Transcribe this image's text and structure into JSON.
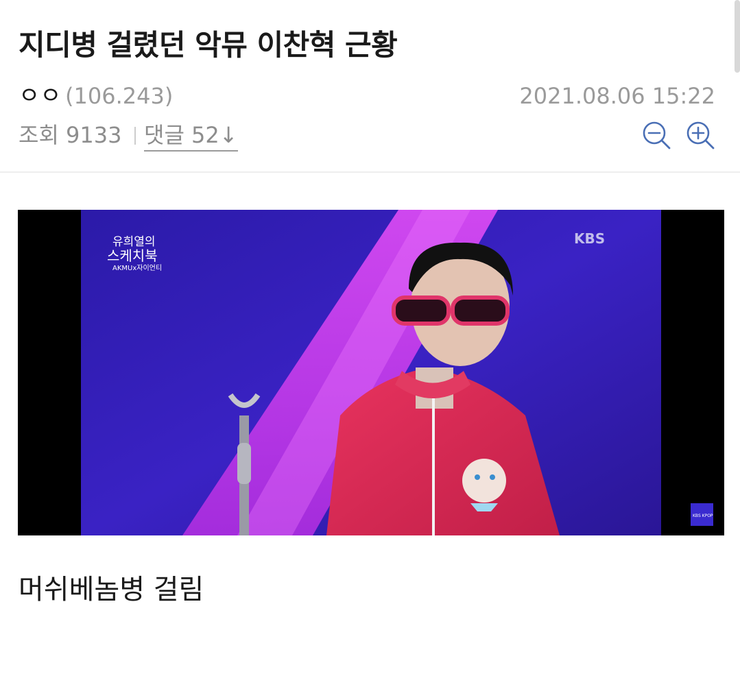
{
  "post": {
    "title": "지디병 걸렸던 악뮤 이찬혁 근황",
    "author": "ㅇㅇ",
    "author_ip": "(106.243)",
    "date": "2021.08.06 15:22",
    "views_label": "조회 9133",
    "comments_label": "댓글 52↓",
    "body_text": "머쉬베놈병 걸림"
  },
  "image": {
    "broadcaster_logo": "KBS",
    "show_logo_line1": "유희열의",
    "show_logo_line2": "스케치북",
    "show_logo_line3": "AKMUx자이언티",
    "corner_badge": "KBS KPOP"
  },
  "icons": {
    "zoom_out": "zoom-out-icon",
    "zoom_in": "zoom-in-icon"
  },
  "colors": {
    "icon_blue": "#4a6fb5",
    "meta_gray": "#8d8d8d",
    "stage_purple": "#3a1fb0",
    "spotlight_pink": "#d63cf0",
    "jacket_red": "#d62a52"
  }
}
